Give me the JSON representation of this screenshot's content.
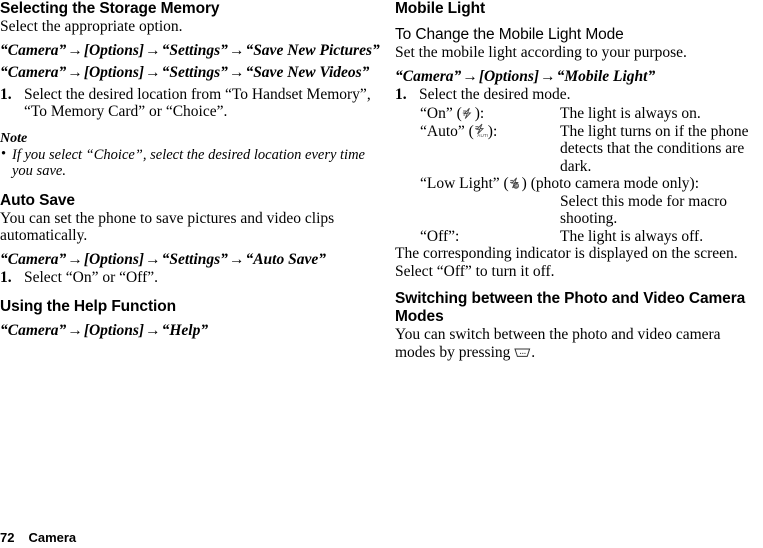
{
  "document": {
    "footer": {
      "page_number": "72",
      "chapter": "Camera"
    }
  },
  "left_column": {
    "section_storage": {
      "heading": "Selecting the Storage Memory",
      "intro": "Select the appropriate option.",
      "path_pictures": {
        "part1": "“Camera”",
        "arrow1": "→",
        "part2": "[Options]",
        "arrow2": "→",
        "part3": "“Settings”",
        "arrow3": "→",
        "part4": "“Save New Pictures”"
      },
      "path_videos": {
        "part1": "“Camera”",
        "arrow1": "→",
        "part2": "[Options]",
        "arrow2": "→",
        "part3": "“Settings”",
        "arrow3": "→",
        "part4": "“Save New Videos”"
      },
      "step1_number": "1.",
      "step1_text": "Select the desired location from “To Handset Memory”, “To Memory Card” or “Choice”.",
      "note_title": "Note",
      "note_bullet": "•",
      "note_text": "If you select “Choice”, select the desired location every time you save."
    },
    "section_autosave": {
      "heading": "Auto Save",
      "intro": "You can set the phone to save pictures and video clips automatically.",
      "path": {
        "part1": "“Camera”",
        "arrow1": "→",
        "part2": "[Options]",
        "arrow2": "→",
        "part3": "“Settings”",
        "arrow3": "→",
        "part4": "“Auto Save”"
      },
      "step1_number": "1.",
      "step1_text": "Select “On” or “Off”."
    },
    "section_help": {
      "heading": "Using the Help Function",
      "path": {
        "part1": "“Camera”",
        "arrow1": "→",
        "part2": "[Options]",
        "arrow2": "→",
        "part3": "“Help”"
      }
    }
  },
  "right_column": {
    "section_mobile_light": {
      "heading": "Mobile Light",
      "subheading": "To Change the Mobile Light Mode",
      "intro": "Set the mobile light according to your purpose.",
      "path": {
        "part1": "“Camera”",
        "arrow1": "→",
        "part2": "[Options]",
        "arrow2": "→",
        "part3": "“Mobile Light”"
      },
      "step1_number": "1.",
      "step1_text": "Select the desired mode.",
      "modes": [
        {
          "term_prefix": "“On” (",
          "icon": "flash-on-icon",
          "term_suffix": "):",
          "description": "The light is always on."
        },
        {
          "term_prefix": "“Auto” (",
          "icon": "flash-auto-icon",
          "term_suffix": "):",
          "description": "The light turns on if the phone detects that the conditions are dark."
        },
        {
          "term_prefix": "“Low Light” (",
          "icon": "flash-low-light-icon",
          "term_suffix": ") (photo camera mode only):",
          "description": "Select this mode for macro shooting."
        },
        {
          "term_prefix": "“Off”:",
          "icon": null,
          "term_suffix": "",
          "description": "The light is always off."
        }
      ],
      "closing_text": "The corresponding indicator is displayed on the screen. Select “Off” to turn it off."
    },
    "section_switching": {
      "heading": "Switching between the Photo and Video Camera Modes",
      "text_before_icon": "You can switch between the photo and video camera modes by pressing",
      "key_icon": "soft-key-icon",
      "text_after_icon": "."
    }
  }
}
